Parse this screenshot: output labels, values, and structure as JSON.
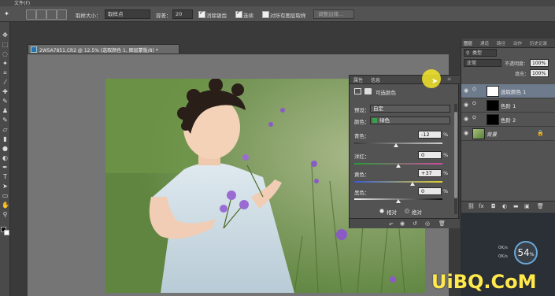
{
  "menu": {
    "items": [
      "文件(F)"
    ]
  },
  "options": {
    "sample_size_label": "取样大小：",
    "sample_size_value": "取样点",
    "tolerance_label": "容差：",
    "tolerance_value": "20",
    "antialias_label": "消除锯齿",
    "contiguous_label": "连续",
    "all_layers_label": "对所有图层取样",
    "refine_edge_button": "调整边缘..."
  },
  "document": {
    "tab_title": "2W5A7851.CR2 @ 12.5% (选取颜色 1, 图层蒙版/8) *"
  },
  "properties": {
    "tabs": [
      "属性",
      "信息"
    ],
    "title": "可选颜色",
    "preset_label": "预设：",
    "preset_value": "自定",
    "colors_label": "颜色：",
    "colors_value": "绿色",
    "cyan_label": "青色：",
    "cyan_value": "-12",
    "magenta_label": "洋红：",
    "magenta_value": "0",
    "yellow_label": "黄色：",
    "yellow_value": "+37",
    "black_label": "黑色：",
    "black_value": "0",
    "pct": "%",
    "relative_label": "相对",
    "absolute_label": "绝对"
  },
  "layers": {
    "tabs": [
      "图层",
      "通道",
      "路径",
      "动作",
      "历史记录"
    ],
    "kind_label": "类型",
    "blend_mode": "正常",
    "opacity_label": "不透明度：",
    "opacity_value": "100%",
    "fill_label": "填充：",
    "fill_value": "100%",
    "items": [
      {
        "name": "选取颜色 1"
      },
      {
        "name": "色阶 1"
      },
      {
        "name": "色阶 2"
      },
      {
        "name": "背景"
      }
    ]
  },
  "hud": {
    "value": "54",
    "suffix": "%",
    "up": "0K/s",
    "down": "0K/s"
  },
  "watermark": "UiBQ.CoM"
}
